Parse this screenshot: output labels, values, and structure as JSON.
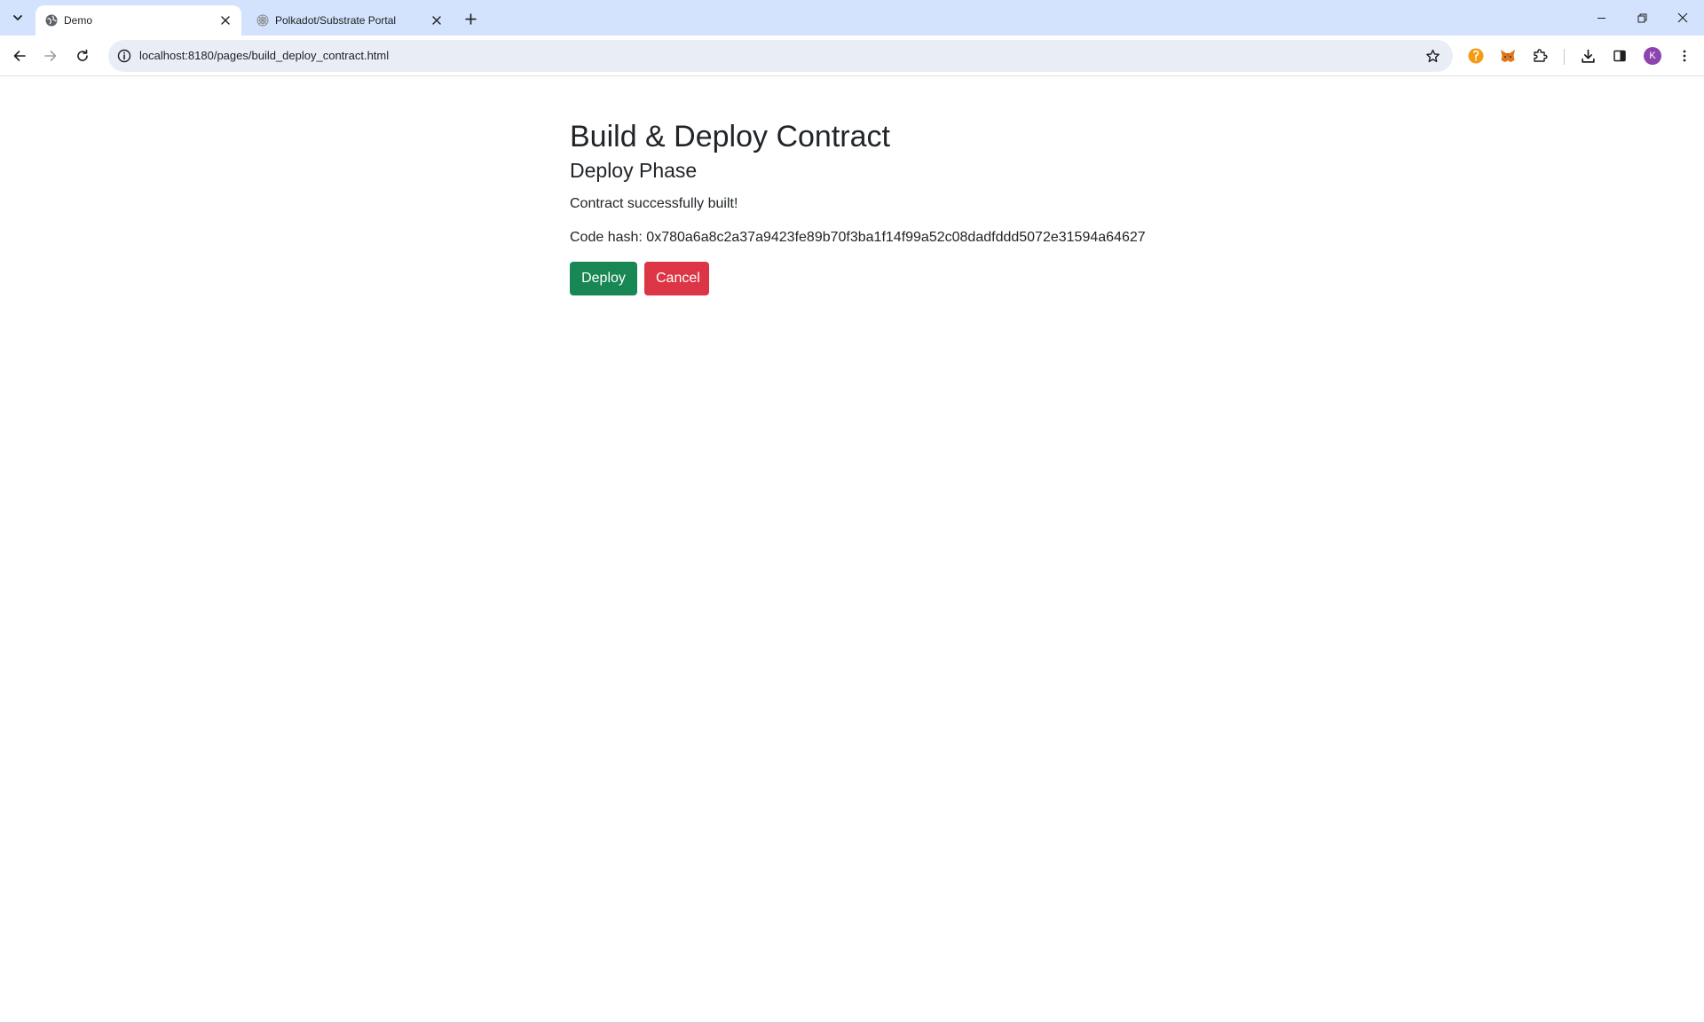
{
  "browser": {
    "tabs": [
      {
        "title": "Demo",
        "active": true
      },
      {
        "title": "Polkadot/Substrate Portal",
        "active": false
      }
    ],
    "url": "localhost:8180/pages/build_deploy_contract.html",
    "profile_initial": "K",
    "icons": {
      "tab_search": "chevron-down-icon",
      "back": "arrow-left-icon",
      "forward": "arrow-right-icon",
      "reload": "reload-icon",
      "site_info": "info-icon",
      "bookmark": "star-icon",
      "extensions": [
        "orange-extension-icon",
        "metamask-fox-icon",
        "puzzle-icon"
      ],
      "download": "download-icon",
      "side_panel": "side-panel-icon",
      "menu": "kebab-menu-icon"
    },
    "colors": {
      "tabstrip": "#d3e3fd",
      "omnibox": "#e9eef6",
      "profile": "#8e44ad"
    }
  },
  "page": {
    "title": "Build & Deploy Contract",
    "phase": "Deploy Phase",
    "status": "Contract successfully built!",
    "code_hash_label": "Code hash:",
    "code_hash_value": "0x780a6a8c2a37a9423fe89b70f3ba1f14f99a52c08dadfddd5072e31594a64627",
    "deploy_label": "Deploy",
    "cancel_label": "Cancel",
    "colors": {
      "deploy": "#198754",
      "cancel": "#dc3545",
      "text": "#212529"
    }
  }
}
